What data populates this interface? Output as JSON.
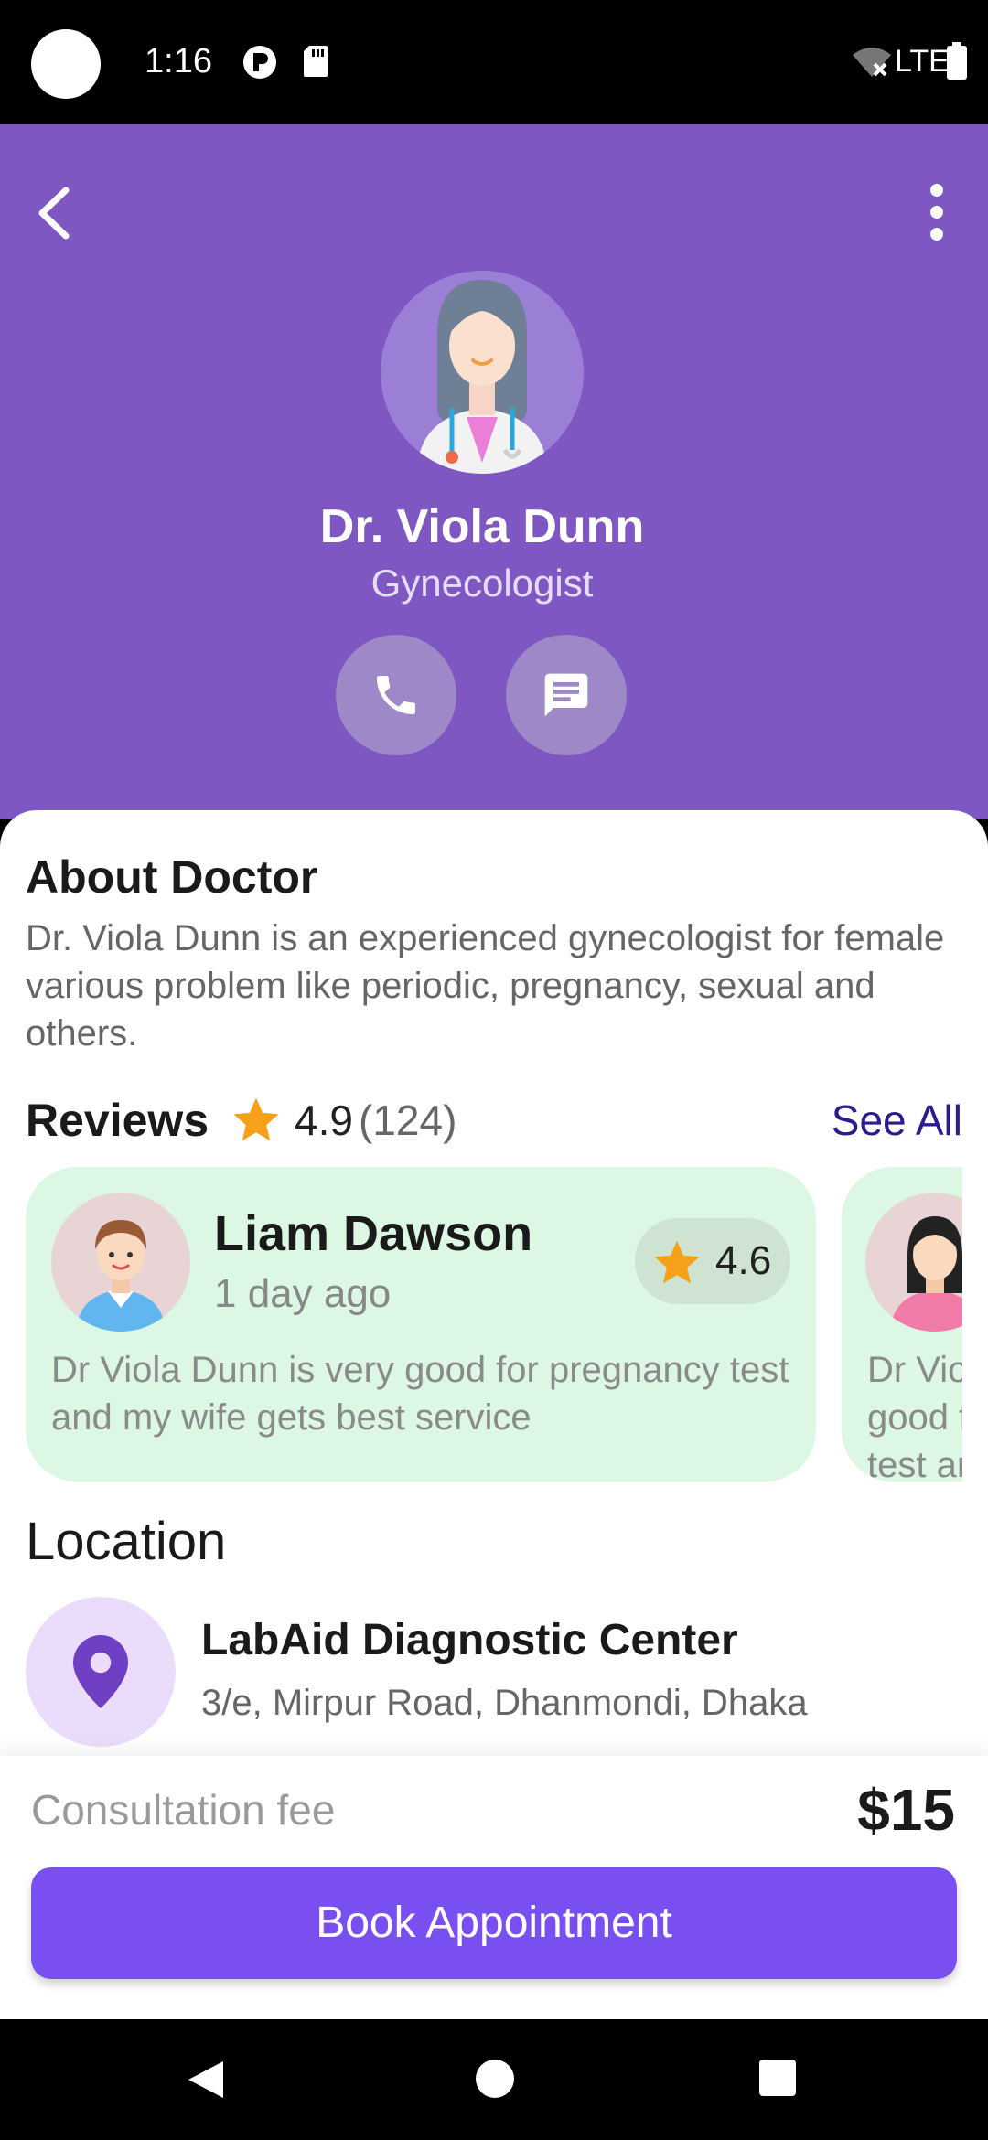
{
  "status_bar": {
    "time": "1:16",
    "network": "LTE"
  },
  "header": {
    "back_icon": "chevron-left-icon",
    "more_icon": "more-vert-icon",
    "doctor_name": "Dr. Viola Dunn",
    "specialty": "Gynecologist",
    "call_icon": "phone-icon",
    "message_icon": "message-icon",
    "background": "#7e57c2"
  },
  "about": {
    "title": "About Doctor",
    "text": "Dr. Viola Dunn is an experienced gynecologist for female various problem like periodic, pregnancy, sexual and others."
  },
  "reviews": {
    "title": "Reviews",
    "rating": "4.9",
    "count": "(124)",
    "see_all": "See All",
    "items": [
      {
        "name": "Liam Dawson",
        "time": "1 day ago",
        "rating": "4.6",
        "text": "Dr Viola Dunn is very good for pregnancy test and my wife gets best service"
      },
      {
        "name": "",
        "time": "",
        "rating": "",
        "text": "Dr Viola Dunn is very good for pregnancy test and my wife gets best service"
      }
    ]
  },
  "location": {
    "title": "Location",
    "name": "LabAid Diagnostic Center",
    "address": "3/e, Mirpur Road, Dhanmondi, Dhaka"
  },
  "booking": {
    "fee_label": "Consultation fee",
    "fee_value": "$15",
    "button_label": "Book Appointment",
    "accent": "#7a4ff2"
  }
}
